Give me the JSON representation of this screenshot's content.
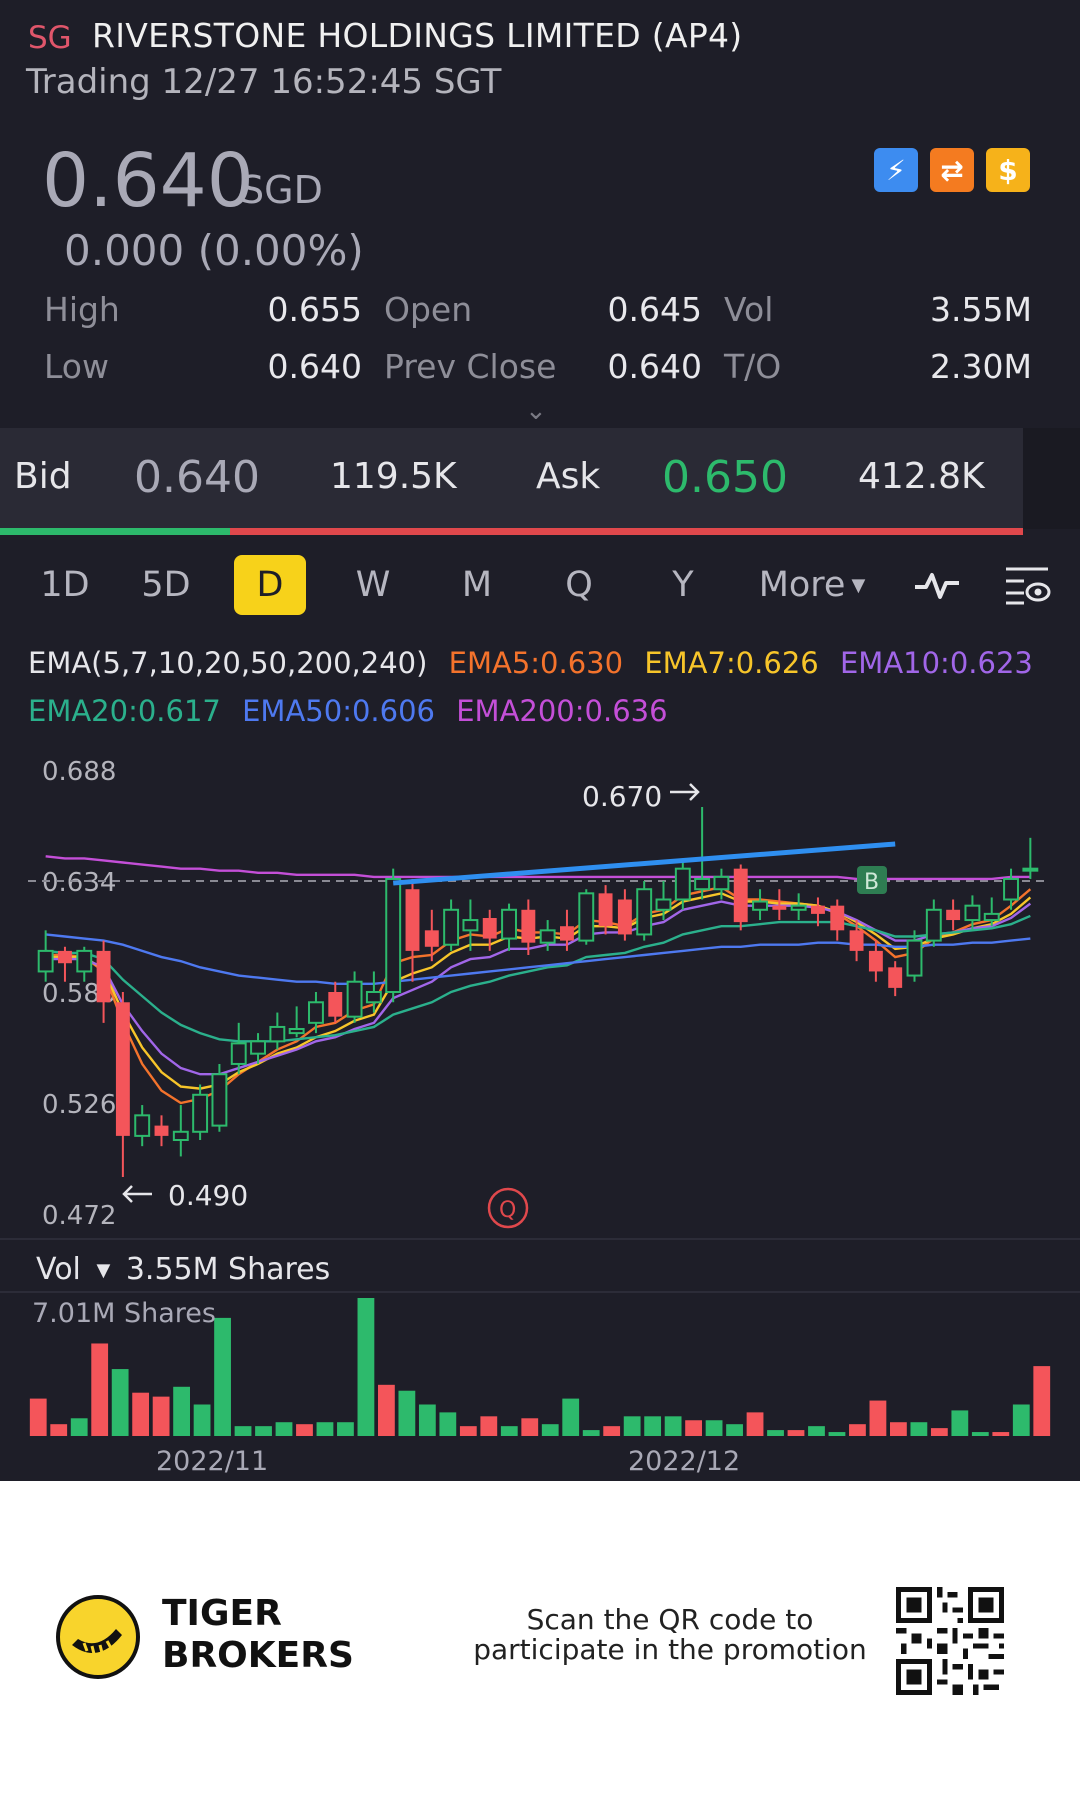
{
  "header": {
    "market": "SG",
    "name": "RIVERSTONE HOLDINGS LIMITED (AP4)",
    "status": "Trading 12/27 16:52:45 SGT",
    "price": "0.640",
    "currency": "SGD",
    "change": "0.000 (0.00%)",
    "badge_icons": [
      "lightning-icon",
      "swap-icon",
      "dollar-icon"
    ]
  },
  "stats": {
    "high_label": "High",
    "high": "0.655",
    "low_label": "Low",
    "low": "0.640",
    "open_label": "Open",
    "open": "0.645",
    "prevclose_label": "Prev Close",
    "prevclose": "0.640",
    "vol_label": "Vol",
    "vol": "3.55M",
    "to_label": "T/O",
    "to": "2.30M"
  },
  "bidask": {
    "bid_label": "Bid",
    "bid_price": "0.640",
    "bid_size": "119.5K",
    "ask_label": "Ask",
    "ask_price": "0.650",
    "ask_size": "412.8K"
  },
  "tabs": [
    "1D",
    "5D",
    "D",
    "W",
    "M",
    "Q",
    "Y",
    "More"
  ],
  "active_tab": "D",
  "ema": {
    "params": "EMA(5,7,10,20,50,200,240)",
    "ema5": "EMA5:0.630",
    "ema7": "EMA7:0.626",
    "ema10": "EMA10:0.623",
    "ema20": "EMA20:0.617",
    "ema50": "EMA50:0.606",
    "ema200": "EMA200:0.636"
  },
  "colors": {
    "up": "#2dba6c",
    "down": "#f4555a",
    "ema5": "#f4732c",
    "ema7": "#f7c52a",
    "ema10": "#a166e8",
    "ema20": "#2bb08c",
    "ema50": "#4e79f0",
    "ema200": "#c44fd8"
  },
  "chart": {
    "y_ticks": [
      "0.688",
      "0.634",
      "0.580",
      "0.526",
      "0.472"
    ],
    "high_label": "0.670",
    "low_label": "0.490",
    "buy_marker": "B",
    "q_marker": "Q",
    "x_labels": [
      "2022/11",
      "2022/12"
    ]
  },
  "volume": {
    "label": "Vol",
    "current": "3.55M Shares",
    "max_label": "7.01M Shares"
  },
  "chart_data": {
    "type": "candlestick",
    "y_axis_range": [
      0.472,
      0.688
    ],
    "candles": [
      {
        "o": 0.59,
        "c": 0.6,
        "h": 0.61,
        "l": 0.585
      },
      {
        "o": 0.6,
        "c": 0.594,
        "h": 0.602,
        "l": 0.585
      },
      {
        "o": 0.59,
        "c": 0.6,
        "h": 0.602,
        "l": 0.585
      },
      {
        "o": 0.6,
        "c": 0.575,
        "h": 0.605,
        "l": 0.565
      },
      {
        "o": 0.575,
        "c": 0.51,
        "h": 0.58,
        "l": 0.49
      },
      {
        "o": 0.51,
        "c": 0.52,
        "h": 0.525,
        "l": 0.505
      },
      {
        "o": 0.515,
        "c": 0.51,
        "h": 0.52,
        "l": 0.505
      },
      {
        "o": 0.508,
        "c": 0.512,
        "h": 0.525,
        "l": 0.5
      },
      {
        "o": 0.512,
        "c": 0.53,
        "h": 0.535,
        "l": 0.508
      },
      {
        "o": 0.515,
        "c": 0.54,
        "h": 0.545,
        "l": 0.512
      },
      {
        "o": 0.545,
        "c": 0.555,
        "h": 0.565,
        "l": 0.54
      },
      {
        "o": 0.55,
        "c": 0.556,
        "h": 0.56,
        "l": 0.545
      },
      {
        "o": 0.556,
        "c": 0.563,
        "h": 0.57,
        "l": 0.552
      },
      {
        "o": 0.56,
        "c": 0.562,
        "h": 0.573,
        "l": 0.558
      },
      {
        "o": 0.565,
        "c": 0.575,
        "h": 0.58,
        "l": 0.56
      },
      {
        "o": 0.58,
        "c": 0.568,
        "h": 0.585,
        "l": 0.565
      },
      {
        "o": 0.568,
        "c": 0.585,
        "h": 0.59,
        "l": 0.565
      },
      {
        "o": 0.575,
        "c": 0.58,
        "h": 0.59,
        "l": 0.57
      },
      {
        "o": 0.58,
        "c": 0.635,
        "h": 0.64,
        "l": 0.575
      },
      {
        "o": 0.63,
        "c": 0.6,
        "h": 0.635,
        "l": 0.585
      },
      {
        "o": 0.61,
        "c": 0.602,
        "h": 0.62,
        "l": 0.595
      },
      {
        "o": 0.603,
        "c": 0.62,
        "h": 0.625,
        "l": 0.6
      },
      {
        "o": 0.61,
        "c": 0.615,
        "h": 0.625,
        "l": 0.6
      },
      {
        "o": 0.616,
        "c": 0.606,
        "h": 0.62,
        "l": 0.6
      },
      {
        "o": 0.606,
        "c": 0.62,
        "h": 0.623,
        "l": 0.6
      },
      {
        "o": 0.62,
        "c": 0.604,
        "h": 0.625,
        "l": 0.598
      },
      {
        "o": 0.604,
        "c": 0.61,
        "h": 0.615,
        "l": 0.6
      },
      {
        "o": 0.612,
        "c": 0.605,
        "h": 0.62,
        "l": 0.6
      },
      {
        "o": 0.605,
        "c": 0.628,
        "h": 0.63,
        "l": 0.603
      },
      {
        "o": 0.628,
        "c": 0.612,
        "h": 0.632,
        "l": 0.608
      },
      {
        "o": 0.625,
        "c": 0.608,
        "h": 0.63,
        "l": 0.605
      },
      {
        "o": 0.608,
        "c": 0.63,
        "h": 0.634,
        "l": 0.605
      },
      {
        "o": 0.62,
        "c": 0.625,
        "h": 0.634,
        "l": 0.615
      },
      {
        "o": 0.625,
        "c": 0.64,
        "h": 0.645,
        "l": 0.62
      },
      {
        "o": 0.63,
        "c": 0.635,
        "h": 0.67,
        "l": 0.625
      },
      {
        "o": 0.63,
        "c": 0.636,
        "h": 0.64,
        "l": 0.625
      },
      {
        "o": 0.64,
        "c": 0.614,
        "h": 0.642,
        "l": 0.61
      },
      {
        "o": 0.62,
        "c": 0.624,
        "h": 0.63,
        "l": 0.615
      },
      {
        "o": 0.622,
        "c": 0.62,
        "h": 0.63,
        "l": 0.615
      },
      {
        "o": 0.62,
        "c": 0.622,
        "h": 0.628,
        "l": 0.615
      },
      {
        "o": 0.622,
        "c": 0.618,
        "h": 0.626,
        "l": 0.612
      },
      {
        "o": 0.622,
        "c": 0.61,
        "h": 0.625,
        "l": 0.605
      },
      {
        "o": 0.61,
        "c": 0.6,
        "h": 0.615,
        "l": 0.595
      },
      {
        "o": 0.6,
        "c": 0.59,
        "h": 0.605,
        "l": 0.585
      },
      {
        "o": 0.592,
        "c": 0.582,
        "h": 0.595,
        "l": 0.578
      },
      {
        "o": 0.588,
        "c": 0.605,
        "h": 0.61,
        "l": 0.585
      },
      {
        "o": 0.605,
        "c": 0.62,
        "h": 0.625,
        "l": 0.602
      },
      {
        "o": 0.62,
        "c": 0.615,
        "h": 0.625,
        "l": 0.61
      },
      {
        "o": 0.615,
        "c": 0.622,
        "h": 0.627,
        "l": 0.61
      },
      {
        "o": 0.615,
        "c": 0.618,
        "h": 0.626,
        "l": 0.612
      },
      {
        "o": 0.625,
        "c": 0.635,
        "h": 0.64,
        "l": 0.62
      },
      {
        "o": 0.64,
        "c": 0.64,
        "h": 0.655,
        "l": 0.635
      }
    ],
    "ema_series": [
      {
        "name": "EMA5",
        "values": [
          0.598,
          0.598,
          0.597,
          0.59,
          0.565,
          0.545,
          0.532,
          0.526,
          0.528,
          0.532,
          0.54,
          0.546,
          0.552,
          0.556,
          0.563,
          0.565,
          0.571,
          0.574,
          0.594,
          0.597,
          0.598,
          0.605,
          0.608,
          0.607,
          0.611,
          0.609,
          0.609,
          0.608,
          0.615,
          0.614,
          0.612,
          0.618,
          0.62,
          0.627,
          0.629,
          0.631,
          0.625,
          0.625,
          0.624,
          0.623,
          0.622,
          0.618,
          0.612,
          0.605,
          0.597,
          0.599,
          0.606,
          0.609,
          0.613,
          0.615,
          0.622,
          0.63
        ]
      },
      {
        "name": "EMA7",
        "values": [
          0.597,
          0.597,
          0.597,
          0.591,
          0.57,
          0.553,
          0.541,
          0.534,
          0.533,
          0.535,
          0.541,
          0.545,
          0.55,
          0.553,
          0.558,
          0.561,
          0.566,
          0.569,
          0.585,
          0.589,
          0.592,
          0.599,
          0.603,
          0.603,
          0.607,
          0.606,
          0.607,
          0.606,
          0.612,
          0.612,
          0.611,
          0.616,
          0.618,
          0.624,
          0.626,
          0.628,
          0.624,
          0.624,
          0.623,
          0.623,
          0.622,
          0.619,
          0.614,
          0.608,
          0.601,
          0.602,
          0.606,
          0.608,
          0.611,
          0.613,
          0.618,
          0.626
        ]
      },
      {
        "name": "EMA10",
        "values": [
          0.596,
          0.596,
          0.596,
          0.592,
          0.574,
          0.561,
          0.55,
          0.543,
          0.54,
          0.54,
          0.543,
          0.546,
          0.549,
          0.552,
          0.556,
          0.558,
          0.562,
          0.565,
          0.577,
          0.581,
          0.585,
          0.592,
          0.596,
          0.597,
          0.601,
          0.601,
          0.603,
          0.603,
          0.608,
          0.609,
          0.609,
          0.612,
          0.614,
          0.62,
          0.622,
          0.624,
          0.622,
          0.622,
          0.622,
          0.622,
          0.621,
          0.619,
          0.615,
          0.61,
          0.605,
          0.605,
          0.608,
          0.609,
          0.611,
          0.612,
          0.616,
          0.623
        ]
      },
      {
        "name": "EMA20",
        "values": [
          0.6,
          0.599,
          0.599,
          0.596,
          0.586,
          0.578,
          0.57,
          0.564,
          0.56,
          0.557,
          0.556,
          0.556,
          0.556,
          0.557,
          0.558,
          0.559,
          0.561,
          0.563,
          0.569,
          0.572,
          0.575,
          0.58,
          0.583,
          0.585,
          0.588,
          0.59,
          0.592,
          0.593,
          0.597,
          0.598,
          0.599,
          0.602,
          0.604,
          0.608,
          0.61,
          0.612,
          0.612,
          0.613,
          0.614,
          0.614,
          0.614,
          0.614,
          0.612,
          0.61,
          0.607,
          0.607,
          0.608,
          0.609,
          0.61,
          0.611,
          0.613,
          0.617
        ]
      },
      {
        "name": "EMA50",
        "values": [
          0.608,
          0.607,
          0.606,
          0.605,
          0.603,
          0.6,
          0.597,
          0.595,
          0.592,
          0.59,
          0.588,
          0.587,
          0.586,
          0.585,
          0.585,
          0.584,
          0.584,
          0.584,
          0.585,
          0.586,
          0.587,
          0.588,
          0.589,
          0.59,
          0.591,
          0.592,
          0.593,
          0.594,
          0.595,
          0.596,
          0.597,
          0.598,
          0.599,
          0.6,
          0.601,
          0.602,
          0.602,
          0.603,
          0.603,
          0.603,
          0.604,
          0.604,
          0.603,
          0.603,
          0.602,
          0.602,
          0.603,
          0.603,
          0.604,
          0.604,
          0.605,
          0.606
        ]
      },
      {
        "name": "EMA200",
        "values": [
          0.646,
          0.645,
          0.645,
          0.644,
          0.643,
          0.642,
          0.641,
          0.64,
          0.64,
          0.639,
          0.639,
          0.638,
          0.638,
          0.637,
          0.637,
          0.637,
          0.637,
          0.636,
          0.636,
          0.636,
          0.636,
          0.636,
          0.636,
          0.636,
          0.636,
          0.636,
          0.636,
          0.636,
          0.636,
          0.636,
          0.636,
          0.636,
          0.636,
          0.636,
          0.636,
          0.636,
          0.636,
          0.636,
          0.636,
          0.636,
          0.636,
          0.636,
          0.635,
          0.635,
          0.635,
          0.635,
          0.635,
          0.635,
          0.635,
          0.635,
          0.636,
          0.636
        ]
      }
    ],
    "trendline": {
      "from": {
        "index": 18,
        "value": 0.633
      },
      "to": {
        "index": 44,
        "value": 0.652
      }
    },
    "reference_line": 0.634,
    "volume_max": 7.01,
    "volume_unit": "M Shares",
    "volumes": [
      {
        "v": 1.9,
        "up": false
      },
      {
        "v": 0.6,
        "up": false
      },
      {
        "v": 0.9,
        "up": true
      },
      {
        "v": 4.7,
        "up": false
      },
      {
        "v": 3.4,
        "up": true
      },
      {
        "v": 2.2,
        "up": false
      },
      {
        "v": 2.0,
        "up": false
      },
      {
        "v": 2.5,
        "up": true
      },
      {
        "v": 1.6,
        "up": true
      },
      {
        "v": 6.0,
        "up": true
      },
      {
        "v": 0.5,
        "up": true
      },
      {
        "v": 0.5,
        "up": true
      },
      {
        "v": 0.7,
        "up": true
      },
      {
        "v": 0.6,
        "up": false
      },
      {
        "v": 0.7,
        "up": true
      },
      {
        "v": 0.7,
        "up": true
      },
      {
        "v": 7.01,
        "up": true
      },
      {
        "v": 2.6,
        "up": false
      },
      {
        "v": 2.3,
        "up": true
      },
      {
        "v": 1.6,
        "up": true
      },
      {
        "v": 1.2,
        "up": true
      },
      {
        "v": 0.5,
        "up": false
      },
      {
        "v": 1.0,
        "up": false
      },
      {
        "v": 0.5,
        "up": true
      },
      {
        "v": 0.9,
        "up": false
      },
      {
        "v": 0.6,
        "up": true
      },
      {
        "v": 1.9,
        "up": true
      },
      {
        "v": 0.3,
        "up": true
      },
      {
        "v": 0.5,
        "up": false
      },
      {
        "v": 1.0,
        "up": true
      },
      {
        "v": 1.0,
        "up": true
      },
      {
        "v": 1.0,
        "up": true
      },
      {
        "v": 0.8,
        "up": false
      },
      {
        "v": 0.8,
        "up": true
      },
      {
        "v": 0.6,
        "up": true
      },
      {
        "v": 1.2,
        "up": false
      },
      {
        "v": 0.3,
        "up": true
      },
      {
        "v": 0.3,
        "up": false
      },
      {
        "v": 0.5,
        "up": true
      },
      {
        "v": 0.2,
        "up": true
      },
      {
        "v": 0.6,
        "up": false
      },
      {
        "v": 1.8,
        "up": false
      },
      {
        "v": 0.7,
        "up": false
      },
      {
        "v": 0.7,
        "up": true
      },
      {
        "v": 0.4,
        "up": false
      },
      {
        "v": 1.3,
        "up": true
      },
      {
        "v": 0.2,
        "up": true
      },
      {
        "v": 0.2,
        "up": false
      },
      {
        "v": 1.6,
        "up": true
      },
      {
        "v": 3.55,
        "up": false
      }
    ]
  },
  "footer": {
    "brand_line1": "TIGER",
    "brand_line2": "BROKERS",
    "promo_line1": "Scan the QR code to",
    "promo_line2": "participate in the promotion"
  }
}
